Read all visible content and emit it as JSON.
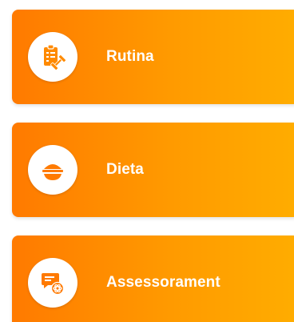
{
  "menu": {
    "items": [
      {
        "label": "Rutina",
        "icon": "clipboard-dumbbell-icon"
      },
      {
        "label": "Dieta",
        "icon": "food-bowl-icon"
      },
      {
        "label": "Assessorament",
        "icon": "chat-ai-icon"
      }
    ]
  },
  "colors": {
    "accent_start": "#ff7a00",
    "accent_end": "#ffad00",
    "label_text": "#ffffff",
    "icon_bg": "#ffffff"
  }
}
